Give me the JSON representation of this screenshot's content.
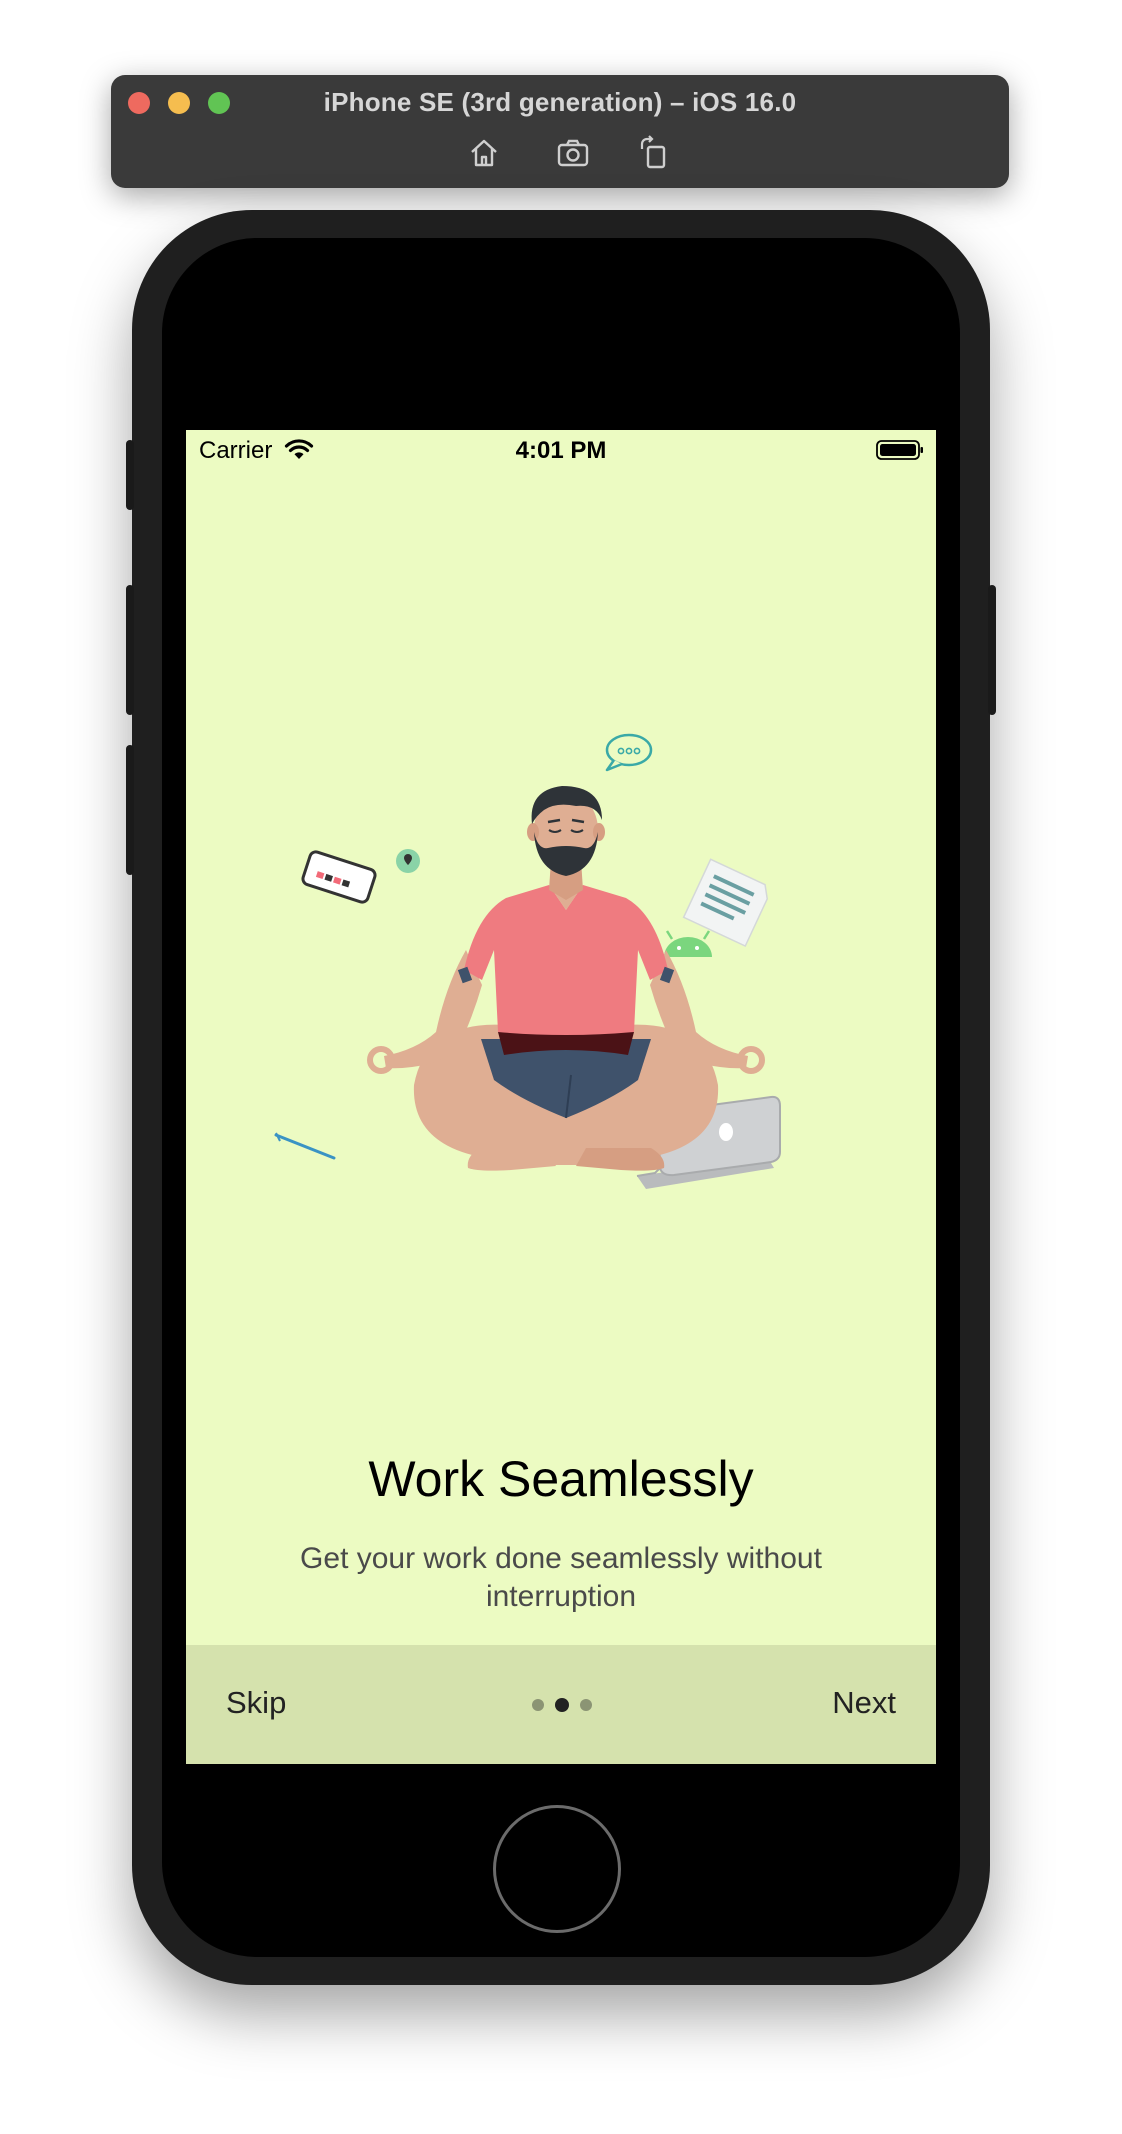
{
  "simulator": {
    "title": "iPhone SE (3rd generation) – iOS 16.0",
    "tools": [
      "home-icon",
      "screenshot-icon",
      "rotate-icon"
    ]
  },
  "status_bar": {
    "carrier": "Carrier",
    "time": "4:01 PM",
    "icons": [
      "wifi-icon",
      "battery-icon"
    ]
  },
  "onboarding": {
    "illustration": "meditating-man-illustration",
    "title": "Work Seamlessly",
    "subtitle": "Get your work done seamlessly without interruption",
    "page_count": 3,
    "current_page": 2
  },
  "bottom_bar": {
    "skip_label": "Skip",
    "next_label": "Next"
  },
  "colors": {
    "screen_background": "#ecfbc2",
    "bottom_bar_background": "#d5e2ad",
    "shirt": "#ef7b80",
    "shorts": "#3f526b"
  }
}
